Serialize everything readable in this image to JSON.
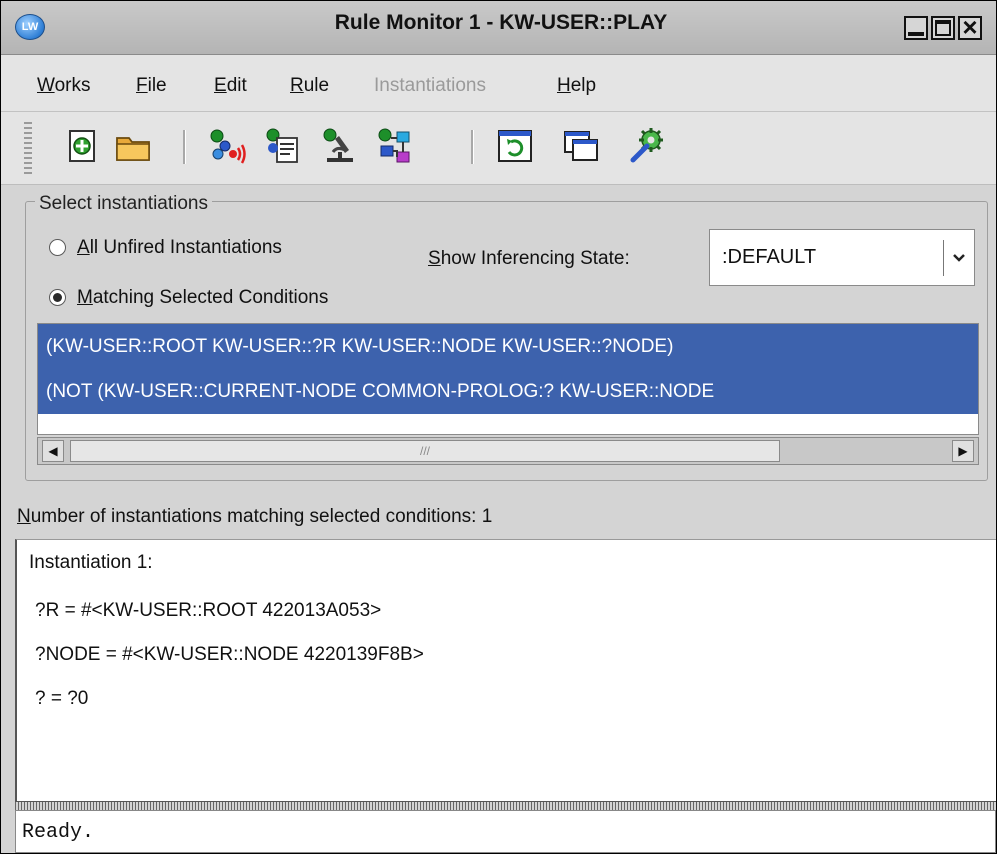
{
  "window": {
    "title": "Rule Monitor 1 - KW-USER::PLAY",
    "app_icon_text": "LW"
  },
  "menu": {
    "items": [
      {
        "mnemonic": "W",
        "rest": "orks"
      },
      {
        "mnemonic": "F",
        "rest": "ile"
      },
      {
        "mnemonic": "E",
        "rest": "dit"
      },
      {
        "mnemonic": "R",
        "rest": "ule"
      },
      {
        "label": "Instantiations"
      },
      {
        "mnemonic": "H",
        "rest": "elp"
      }
    ]
  },
  "toolbar": {
    "icons": [
      "new-icon",
      "open-folder-icon",
      "rule-signal-icon",
      "rule-document-icon",
      "rule-microscope-icon",
      "rule-network-icon",
      "refresh-window-icon",
      "windows-icon",
      "settings-gear-icon"
    ]
  },
  "select": {
    "group_title": "Select instantiations",
    "option_all": {
      "mnemonic": "A",
      "rest": "ll Unfired Instantiations",
      "checked": false
    },
    "option_matching": {
      "mnemonic": "M",
      "rest": "atching Selected Conditions",
      "checked": true
    },
    "state_label": {
      "mnemonic": "S",
      "rest": "how Inferencing State:"
    },
    "state_value": ":DEFAULT"
  },
  "conditions": [
    "(KW-USER::ROOT KW-USER::?R KW-USER::NODE KW-USER::?NODE)",
    "(NOT (KW-USER::CURRENT-NODE COMMON-PROLOG:? KW-USER::NODE"
  ],
  "count": {
    "mnemonic": "N",
    "rest": "umber of instantiations matching selected conditions: 1"
  },
  "detail": {
    "lines": [
      "Instantiation 1:",
      "?R = #<KW-USER::ROOT 422013A053>",
      "?NODE = #<KW-USER::NODE 4220139F8B>",
      "? = ?0"
    ]
  },
  "status": "Ready."
}
